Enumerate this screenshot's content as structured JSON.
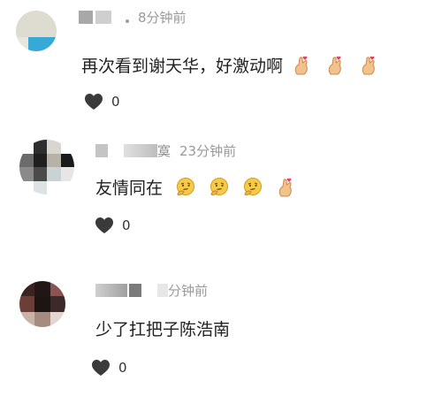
{
  "comments": [
    {
      "time": "8分钟前",
      "text": "再次看到谢天华，好激动啊",
      "emojis": [
        "finger-heart-icon",
        "finger-heart-icon",
        "finger-heart-icon"
      ],
      "likes": "0"
    },
    {
      "username_partial": "寞",
      "time": "23分钟前",
      "text": "友情同在",
      "emojis": [
        "thinking-face-icon",
        "thinking-face-icon",
        "thinking-face-icon",
        "finger-heart-icon"
      ],
      "likes": "0"
    },
    {
      "time": "分钟前",
      "text": "少了扛把子陈浩南",
      "emojis": [],
      "likes": "0"
    }
  ],
  "colors": {
    "text": "#222222",
    "meta": "#9a9a9a",
    "heart": "#3a3a3a",
    "avatar1_top": "#dcdad0",
    "avatar1_bottom": "#38a8d4"
  }
}
